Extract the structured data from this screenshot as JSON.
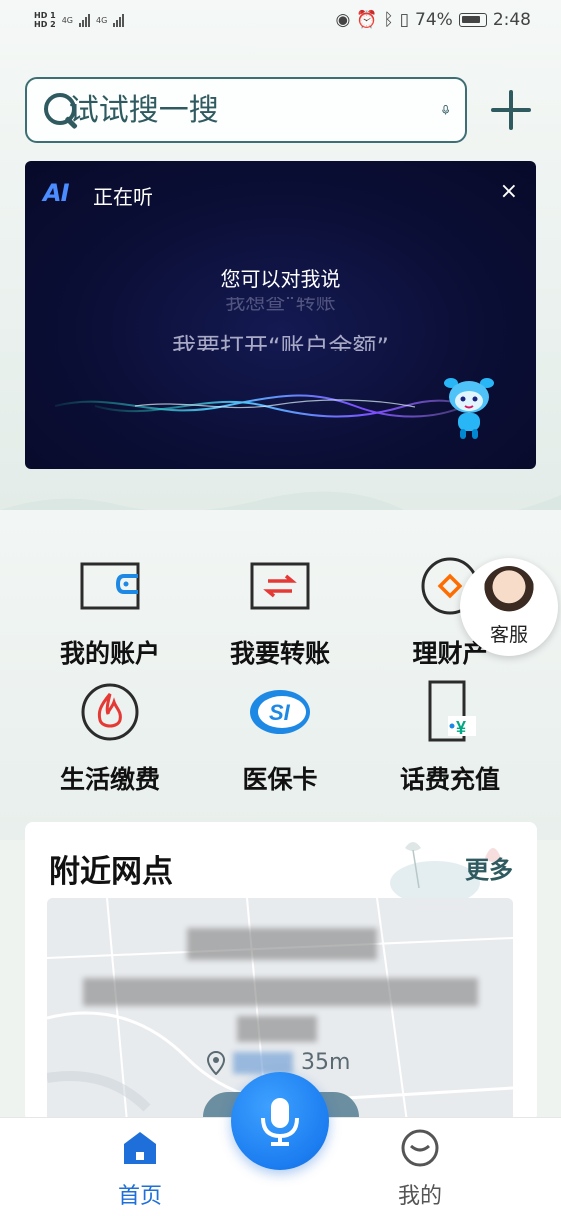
{
  "status_bar": {
    "sim1": "HD 1",
    "sim2": "HD 2",
    "net1": "4G",
    "net2": "4G",
    "battery": "74%",
    "time": "2:48"
  },
  "search": {
    "placeholder": "试试搜一搜",
    "icon": "search-icon",
    "mic_icon": "mic-icon",
    "add_icon": "plus-icon"
  },
  "ai_panel": {
    "logo": "AI",
    "status": "正在听",
    "close": "×",
    "hint": "您可以对我说",
    "suggestion_faded": "我想查“转账",
    "suggestion": "我要打开“账户余额”"
  },
  "functions": [
    {
      "label": "我的账户",
      "icon": "wallet-icon"
    },
    {
      "label": "我要转账",
      "icon": "transfer-icon"
    },
    {
      "label": "理财产",
      "icon": "wealth-icon"
    },
    {
      "label": "生活缴费",
      "icon": "fire-icon"
    },
    {
      "label": "医保卡",
      "icon": "social-security-icon"
    },
    {
      "label": "话费充值",
      "icon": "phone-recharge-icon"
    }
  ],
  "customer_service": {
    "label": "客服"
  },
  "nearby": {
    "title": "附近网点",
    "more": "更多",
    "distance_suffix": "35m"
  },
  "bottom_nav": {
    "home": "首页",
    "mine": "我的"
  },
  "colors": {
    "accent": "#1e6fd9",
    "teal": "#2f5b60",
    "ai_bg": "#0b0e35",
    "red_icon": "#e53935"
  }
}
